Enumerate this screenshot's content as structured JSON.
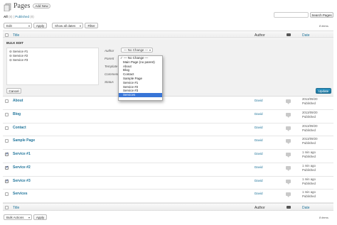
{
  "header": {
    "title": "Pages",
    "add_new": "Add New",
    "search_button": "Search Pages"
  },
  "subsubsub": {
    "all": "All",
    "all_count": "(8)",
    "sep": "|",
    "published": "Published",
    "published_count": "(8)"
  },
  "tablenav_top": {
    "bulk_select": "Edit",
    "apply": "Apply",
    "date_filter": "Show all dates",
    "filter": "Filter",
    "items": "8 items"
  },
  "columns": {
    "title": "Title",
    "author": "Author",
    "date": "Date"
  },
  "bulk_edit": {
    "heading": "BULK EDIT",
    "pages": [
      "Service #1",
      "Service #2",
      "Service #3"
    ],
    "author_label": "Author",
    "author_value": "— No Change —",
    "parent_label": "Parent",
    "template_label": "Template",
    "comments_label": "Comments",
    "status_label": "Status",
    "cancel": "Cancel",
    "update": "Update"
  },
  "parent_dropdown": {
    "checked_item": "— No Change —",
    "items": [
      "Main Page (no parent)",
      "About",
      "Blog",
      "Contact",
      "Sample Page",
      "Service #1",
      "Service #2",
      "Service #3",
      "Services"
    ],
    "selected": "Services"
  },
  "rows": [
    {
      "title": "About",
      "author": "David",
      "date": "2013/09/20",
      "status": "Published",
      "checked": false
    },
    {
      "title": "Blog",
      "author": "David",
      "date": "2013/09/20",
      "status": "Published",
      "checked": false
    },
    {
      "title": "Contact",
      "author": "David",
      "date": "2013/09/20",
      "status": "Published",
      "checked": false
    },
    {
      "title": "Sample Page",
      "author": "David",
      "date": "2013/09/20",
      "status": "Published",
      "checked": false
    },
    {
      "title": "Service #1",
      "author": "David",
      "date": "1 min ago",
      "status": "Published",
      "checked": true
    },
    {
      "title": "Service #2",
      "author": "David",
      "date": "1 min ago",
      "status": "Published",
      "checked": true
    },
    {
      "title": "Service #3",
      "author": "David",
      "date": "1 min ago",
      "status": "Published",
      "checked": true
    },
    {
      "title": "Services",
      "author": "David",
      "date": "1 min ago",
      "status": "Published",
      "checked": false
    }
  ],
  "tablenav_bottom": {
    "bulk_select": "Bulk Actions",
    "apply": "Apply",
    "items": "8 items"
  },
  "colors": {
    "link": "#21759b",
    "primary_button": "#21759b",
    "dropdown_highlight": "#3875d7"
  }
}
